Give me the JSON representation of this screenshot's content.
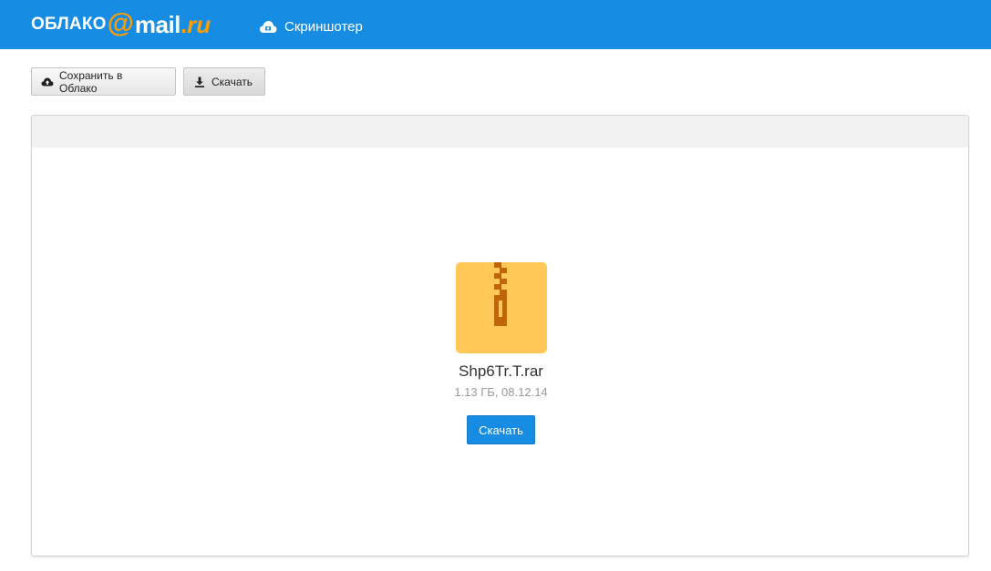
{
  "header": {
    "logo": {
      "prefix": "ОБЛАКО",
      "at": "@",
      "mail": "mail",
      "dot": ".",
      "ru": "ru"
    },
    "screenshoter_label": "Скриншотер",
    "brand_color": "#168de2",
    "accent_color": "#ff9e00"
  },
  "toolbar": {
    "save_label": "Сохранить в Облако",
    "download_label": "Скачать",
    "save_icon": "cloud-upload-icon",
    "download_icon": "download-icon"
  },
  "file": {
    "name": "Shp6Tr.T.rar",
    "meta": "1.13 ГБ, 08.12.14",
    "icon": "archive-zip-icon",
    "icon_color": "#ffc857",
    "download_button_label": "Скачать"
  }
}
